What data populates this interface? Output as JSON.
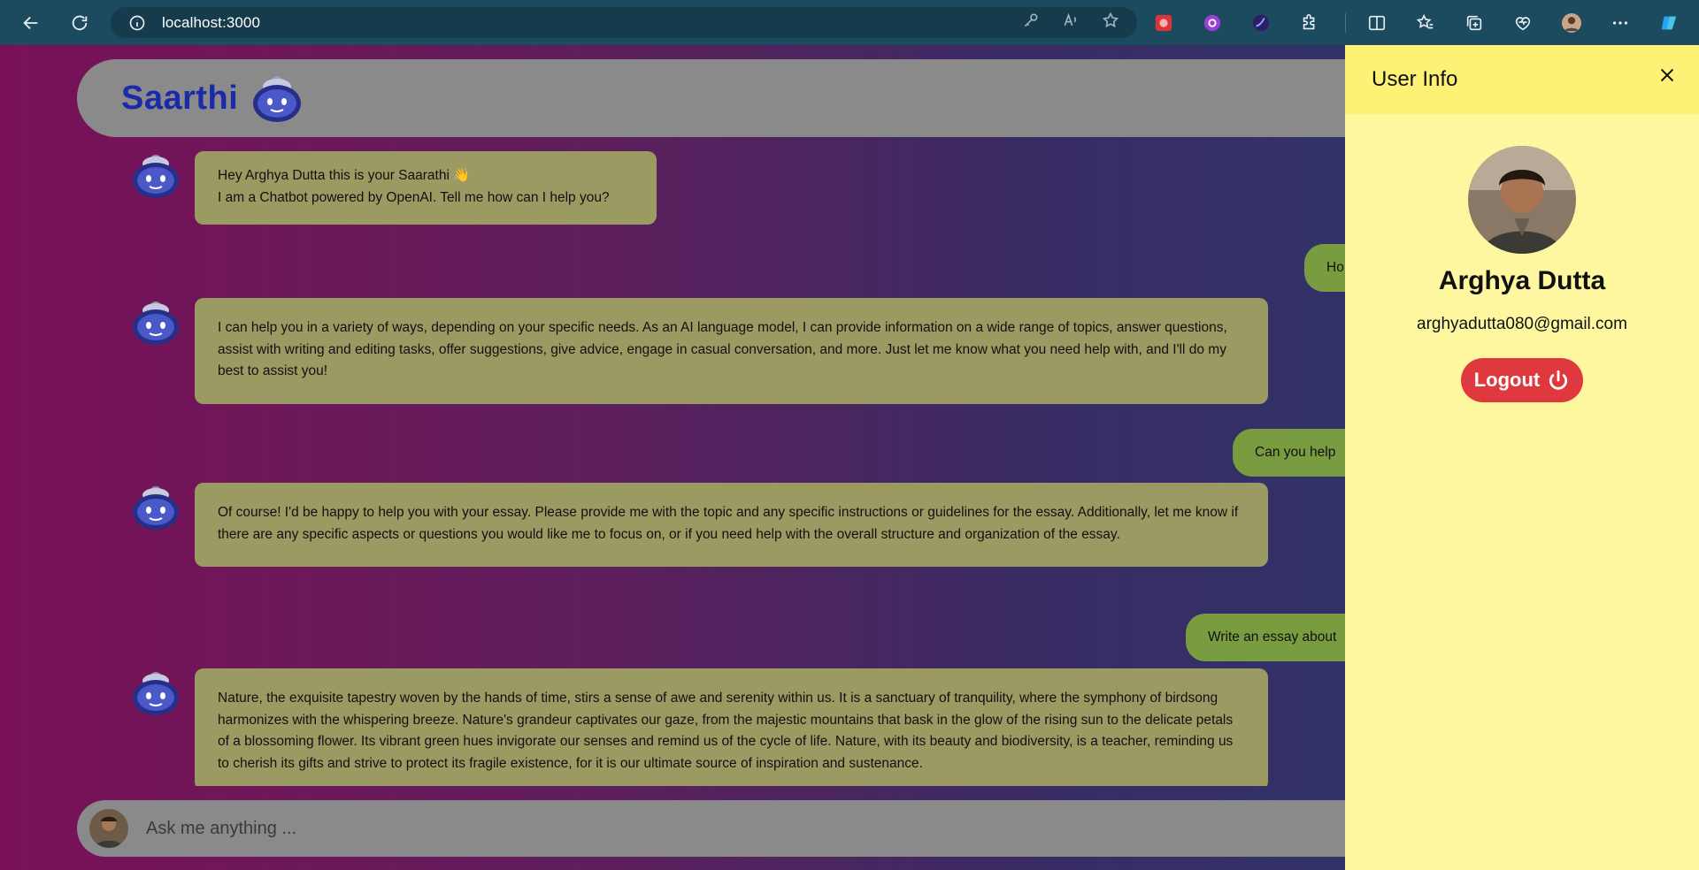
{
  "browser": {
    "url": "localhost:3000",
    "accent": "#1c4a5e",
    "toolbar_icons": [
      "back-icon",
      "reload-icon",
      "info-icon",
      "key-icon",
      "read-aloud-icon",
      "favorite-star-icon"
    ],
    "extensions": [
      "red-extension-icon",
      "purple-extension-icon",
      "dark-orb-extension-icon",
      "puzzle-extensions-icon",
      "split-screen-icon",
      "favorites-icon",
      "collections-icon",
      "browser-essentials-icon",
      "profile-avatar",
      "more-menu-icon",
      "copilot-icon"
    ]
  },
  "app": {
    "brand": "Saarthi",
    "brand_color": "#1a2aa8",
    "gradient": [
      "#7a1157",
      "#5e1e5c",
      "#3a2b63",
      "#283a70"
    ]
  },
  "chat": {
    "messages": [
      {
        "role": "bot",
        "lines": [
          "Hey Arghya Dutta this is your Saarathi 👋",
          "I am a Chatbot powered by OpenAI. Tell me how can I help you?"
        ]
      },
      {
        "role": "user",
        "text": "Ho"
      },
      {
        "role": "bot",
        "lines": [
          "I can help you in a variety of ways, depending on your specific needs. As an AI language model, I can provide information on a wide range of topics, answer questions, assist with writing and editing tasks, offer suggestions, give advice, engage in casual conversation, and more. Just let me know what you need help with, and I'll do my best to assist you!"
        ]
      },
      {
        "role": "user",
        "text": "Can you help"
      },
      {
        "role": "bot",
        "lines": [
          "Of course! I'd be happy to help you with your essay. Please provide me with the topic and any specific instructions or guidelines for the essay. Additionally, let me know if there are any specific aspects or questions you would like me to focus on, or if you need help with the overall structure and organization of the essay."
        ]
      },
      {
        "role": "user",
        "text": "Write an essay about"
      },
      {
        "role": "bot",
        "lines": [
          "Nature, the exquisite tapestry woven by the hands of time, stirs a sense of awe and serenity within us. It is a sanctuary of tranquility, where the symphony of birdsong harmonizes with the whispering breeze. Nature's grandeur captivates our gaze, from the majestic mountains that bask in the glow of the rising sun to the delicate petals of a blossoming flower. Its vibrant green hues invigorate our senses and remind us of the cycle of life. Nature, with its beauty and biodiversity, is a teacher, reminding us to cherish its gifts and strive to protect its fragile existence, for it is our ultimate source of inspiration and sustenance."
        ]
      }
    ],
    "bot_bubble_color": "#9a9a62",
    "user_bubble_color": "#7a9c40"
  },
  "input": {
    "placeholder": "Ask me anything ...",
    "value": ""
  },
  "user_panel": {
    "title": "User Info",
    "name": "Arghya Dutta",
    "email": "arghyadutta080@gmail.com",
    "logout_label": "Logout",
    "logout_color": "#e0383f",
    "header_color": "#fdf176",
    "body_color": "#fef7a0"
  }
}
